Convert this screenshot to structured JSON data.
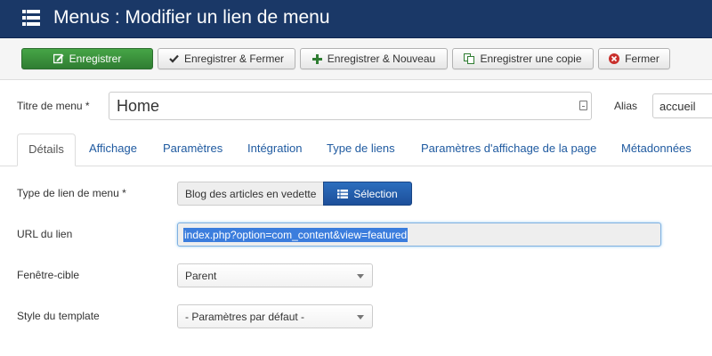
{
  "header": {
    "title": "Menus : Modifier un lien de menu",
    "icon": "list-icon"
  },
  "toolbar": {
    "save_label": "Enregistrer",
    "save_close_label": "Enregistrer & Fermer",
    "save_new_label": "Enregistrer & Nouveau",
    "save_copy_label": "Enregistrer une copie",
    "close_label": "Fermer",
    "colors": {
      "save_green": "#46a546",
      "header_blue": "#1a3867",
      "close_red": "#c9302c"
    }
  },
  "form": {
    "title_label": "Titre de menu *",
    "title_value": "Home",
    "alias_label": "Alias",
    "alias_value": "accueil"
  },
  "tabs": [
    {
      "label": "Détails",
      "active": true
    },
    {
      "label": "Affichage",
      "active": false
    },
    {
      "label": "Paramètres",
      "active": false
    },
    {
      "label": "Intégration",
      "active": false
    },
    {
      "label": "Type de liens",
      "active": false
    },
    {
      "label": "Paramètres d'affichage de la page",
      "active": false
    },
    {
      "label": "Métadonnées",
      "active": false
    }
  ],
  "details": {
    "type_label": "Type de lien de menu *",
    "type_value": "Blog des articles en vedette",
    "select_label": "Sélection",
    "url_label": "URL du lien",
    "url_value": "index.php?option=com_content&view=featured",
    "target_label": "Fenêtre-cible",
    "target_value": "Parent",
    "style_label": "Style du template",
    "style_value": "- Paramètres par défaut -"
  }
}
